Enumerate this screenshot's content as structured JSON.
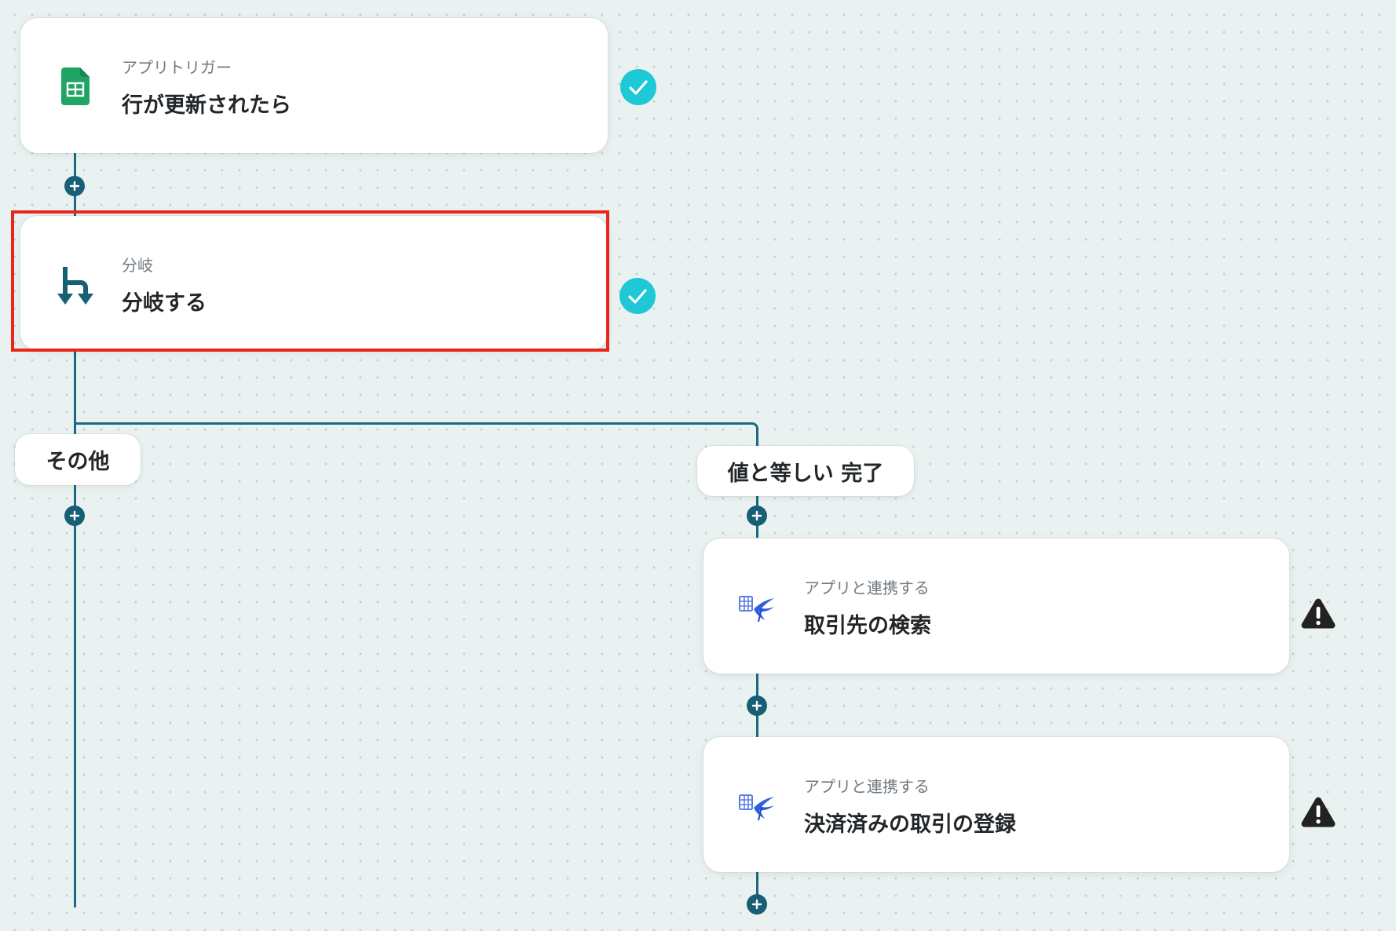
{
  "nodes": [
    {
      "id": "trigger",
      "subtitle": "アプリトリガー",
      "title": "行が更新されたら",
      "icon": "google-sheets-icon",
      "status": "check-icon"
    },
    {
      "id": "branch",
      "subtitle": "分岐",
      "title": "分岐する",
      "icon": "branch-icon",
      "status": "check-icon",
      "selected": true
    },
    {
      "id": "search-partner",
      "subtitle": "アプリと連携する",
      "title": "取引先の検索",
      "icon": "freee-accounting-icon",
      "status": "warning-icon"
    },
    {
      "id": "register-deal",
      "subtitle": "アプリと連携する",
      "title": "決済済みの取引の登録",
      "icon": "freee-accounting-icon",
      "status": "warning-icon"
    }
  ],
  "branches": {
    "other_label": "その他",
    "condition_label": "値と等しい 完了"
  },
  "colors": {
    "connector": "#1b6a80",
    "check": "#1ec8d6",
    "warning": "#222222",
    "selection": "#e8261b",
    "sheets_green": "#1fa463"
  }
}
